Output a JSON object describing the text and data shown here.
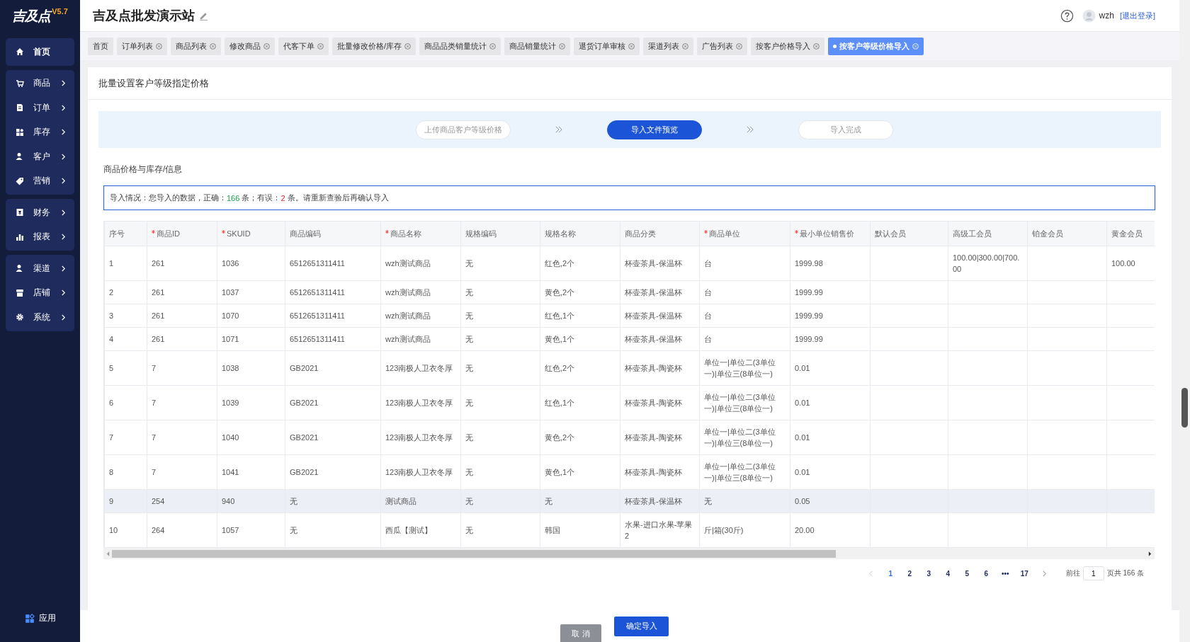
{
  "logo": {
    "text": "吉及点",
    "version": "V5.7"
  },
  "sidebar": {
    "groups": [
      [
        {
          "label": "首页",
          "expandable": false,
          "selected": true
        }
      ],
      [
        {
          "label": "商品",
          "expandable": true,
          "selected": false
        },
        {
          "label": "订单",
          "expandable": true,
          "selected": false
        },
        {
          "label": "库存",
          "expandable": true,
          "selected": false
        },
        {
          "label": "客户",
          "expandable": true,
          "selected": false
        },
        {
          "label": "营销",
          "expandable": true,
          "selected": false
        }
      ],
      [
        {
          "label": "财务",
          "expandable": true,
          "selected": false
        },
        {
          "label": "报表",
          "expandable": true,
          "selected": false
        }
      ],
      [
        {
          "label": "渠道",
          "expandable": true,
          "selected": false
        },
        {
          "label": "店铺",
          "expandable": true,
          "selected": false
        },
        {
          "label": "系统",
          "expandable": true,
          "selected": false
        }
      ]
    ],
    "bottom_item": {
      "label": "应用"
    }
  },
  "header": {
    "title": "吉及点批发演示站",
    "user": "wzh",
    "logout": "[退出登录]"
  },
  "tabs": [
    {
      "label": "首页",
      "closable": false,
      "selected": false
    },
    {
      "label": "订单列表",
      "closable": true,
      "selected": false
    },
    {
      "label": "商品列表",
      "closable": true,
      "selected": false
    },
    {
      "label": "修改商品",
      "closable": true,
      "selected": false
    },
    {
      "label": "代客下单",
      "closable": true,
      "selected": false
    },
    {
      "label": "批量修改价格/库存",
      "closable": true,
      "selected": false
    },
    {
      "label": "商品品类销量统计",
      "closable": true,
      "selected": false
    },
    {
      "label": "商品销量统计",
      "closable": true,
      "selected": false
    },
    {
      "label": "退货订单审核",
      "closable": true,
      "selected": false
    },
    {
      "label": "渠道列表",
      "closable": true,
      "selected": false
    },
    {
      "label": "广告列表",
      "closable": true,
      "selected": false
    },
    {
      "label": "按客户价格导入",
      "closable": true,
      "selected": false
    },
    {
      "label": "按客户等级价格导入",
      "closable": true,
      "selected": true
    }
  ],
  "page": {
    "title": "批量设置客户等级指定价格",
    "steps": [
      {
        "label": "上传商品客户等级价格",
        "selected": false
      },
      {
        "label": "导入文件预览",
        "selected": true
      },
      {
        "label": "导入完成",
        "selected": false
      }
    ],
    "section_title": "商品价格与库存/信息",
    "summary": {
      "before": "导入情况：您导入的数据，正确：",
      "correct": "166",
      "between": " 条；有误：",
      "errors": "2",
      "after": " 条。请重新查验后再确认导入"
    }
  },
  "table": {
    "columns": [
      {
        "label": "序号",
        "required": false
      },
      {
        "label": "商品ID",
        "required": true
      },
      {
        "label": "SKUID",
        "required": true
      },
      {
        "label": "商品编码",
        "required": false
      },
      {
        "label": "商品名称",
        "required": true
      },
      {
        "label": "规格编码",
        "required": false
      },
      {
        "label": "规格名称",
        "required": false
      },
      {
        "label": "商品分类",
        "required": false
      },
      {
        "label": "商品单位",
        "required": true
      },
      {
        "label": "最小单位销售价",
        "required": true
      },
      {
        "label": "默认会员",
        "required": false
      },
      {
        "label": "高级工会员",
        "required": false
      },
      {
        "label": "铂金会员",
        "required": false
      },
      {
        "label": "黄金会员",
        "required": false
      }
    ],
    "rows": [
      {
        "hovered": false,
        "cells": [
          "1",
          "261",
          "1036",
          "6512651311411",
          "wzh测试商品",
          "无",
          "红色,2个",
          "杯壶茶具-保温杯",
          "台",
          "1999.98",
          null,
          "100.00|300.00|700.00",
          null,
          "100.00"
        ]
      },
      {
        "hovered": false,
        "cells": [
          "2",
          "261",
          "1037",
          "6512651311411",
          "wzh测试商品",
          "无",
          "黄色,2个",
          "杯壶茶具-保温杯",
          "台",
          "1999.99",
          null,
          null,
          null,
          null
        ]
      },
      {
        "hovered": false,
        "cells": [
          "3",
          "261",
          "1070",
          "6512651311411",
          "wzh测试商品",
          "无",
          "红色,1个",
          "杯壶茶具-保温杯",
          "台",
          "1999.99",
          null,
          null,
          null,
          null
        ]
      },
      {
        "hovered": false,
        "cells": [
          "4",
          "261",
          "1071",
          "6512651311411",
          "wzh测试商品",
          "无",
          "黄色,1个",
          "杯壶茶具-保温杯",
          "台",
          "1999.99",
          null,
          null,
          null,
          null
        ]
      },
      {
        "hovered": false,
        "cells": [
          "5",
          "7",
          "1038",
          "GB2021",
          "123南极人卫衣冬厚",
          "无",
          "红色,2个",
          "杯壶茶具-陶瓷杯",
          "单位一|单位二(3单位一)|单位三(8单位一)",
          "0.01",
          null,
          null,
          null,
          null
        ]
      },
      {
        "hovered": false,
        "cells": [
          "6",
          "7",
          "1039",
          "GB2021",
          "123南极人卫衣冬厚",
          "无",
          "红色,1个",
          "杯壶茶具-陶瓷杯",
          "单位一|单位二(3单位一)|单位三(8单位一)",
          "0.01",
          null,
          null,
          null,
          null
        ]
      },
      {
        "hovered": false,
        "cells": [
          "7",
          "7",
          "1040",
          "GB2021",
          "123南极人卫衣冬厚",
          "无",
          "黄色,2个",
          "杯壶茶具-陶瓷杯",
          "单位一|单位二(3单位一)|单位三(8单位一)",
          "0.01",
          null,
          null,
          null,
          null
        ]
      },
      {
        "hovered": false,
        "cells": [
          "8",
          "7",
          "1041",
          "GB2021",
          "123南极人卫衣冬厚",
          "无",
          "黄色,1个",
          "杯壶茶具-陶瓷杯",
          "单位一|单位二(3单位一)|单位三(8单位一)",
          "0.01",
          null,
          null,
          null,
          null
        ]
      },
      {
        "hovered": true,
        "cells": [
          "9",
          "254",
          "940",
          "无",
          "测试商品",
          "无",
          "无",
          "杯壶茶具-保温杯",
          "无",
          "0.05",
          null,
          null,
          null,
          null
        ]
      },
      {
        "hovered": false,
        "cells": [
          "10",
          "264",
          "1057",
          "无",
          "西瓜【测试】",
          "无",
          "韩国",
          "水果-进口水果-苹果2",
          "斤|箱(30斤)",
          "20.00",
          null,
          null,
          null,
          null
        ]
      }
    ]
  },
  "pagination": {
    "pages": [
      {
        "label": "1",
        "selected": true
      },
      {
        "label": "2",
        "selected": false
      },
      {
        "label": "3",
        "selected": false
      },
      {
        "label": "4",
        "selected": false
      },
      {
        "label": "5",
        "selected": false
      },
      {
        "label": "6",
        "selected": false
      },
      {
        "label": "•••",
        "selected": false
      },
      {
        "label": "17",
        "selected": false
      }
    ],
    "goto_label": "前往",
    "goto_value": "1",
    "total": "页共 166 条"
  },
  "buttons": [
    {
      "label": "取 消",
      "kind": "secondary"
    },
    {
      "label": "确定导入",
      "kind": "primary"
    }
  ]
}
